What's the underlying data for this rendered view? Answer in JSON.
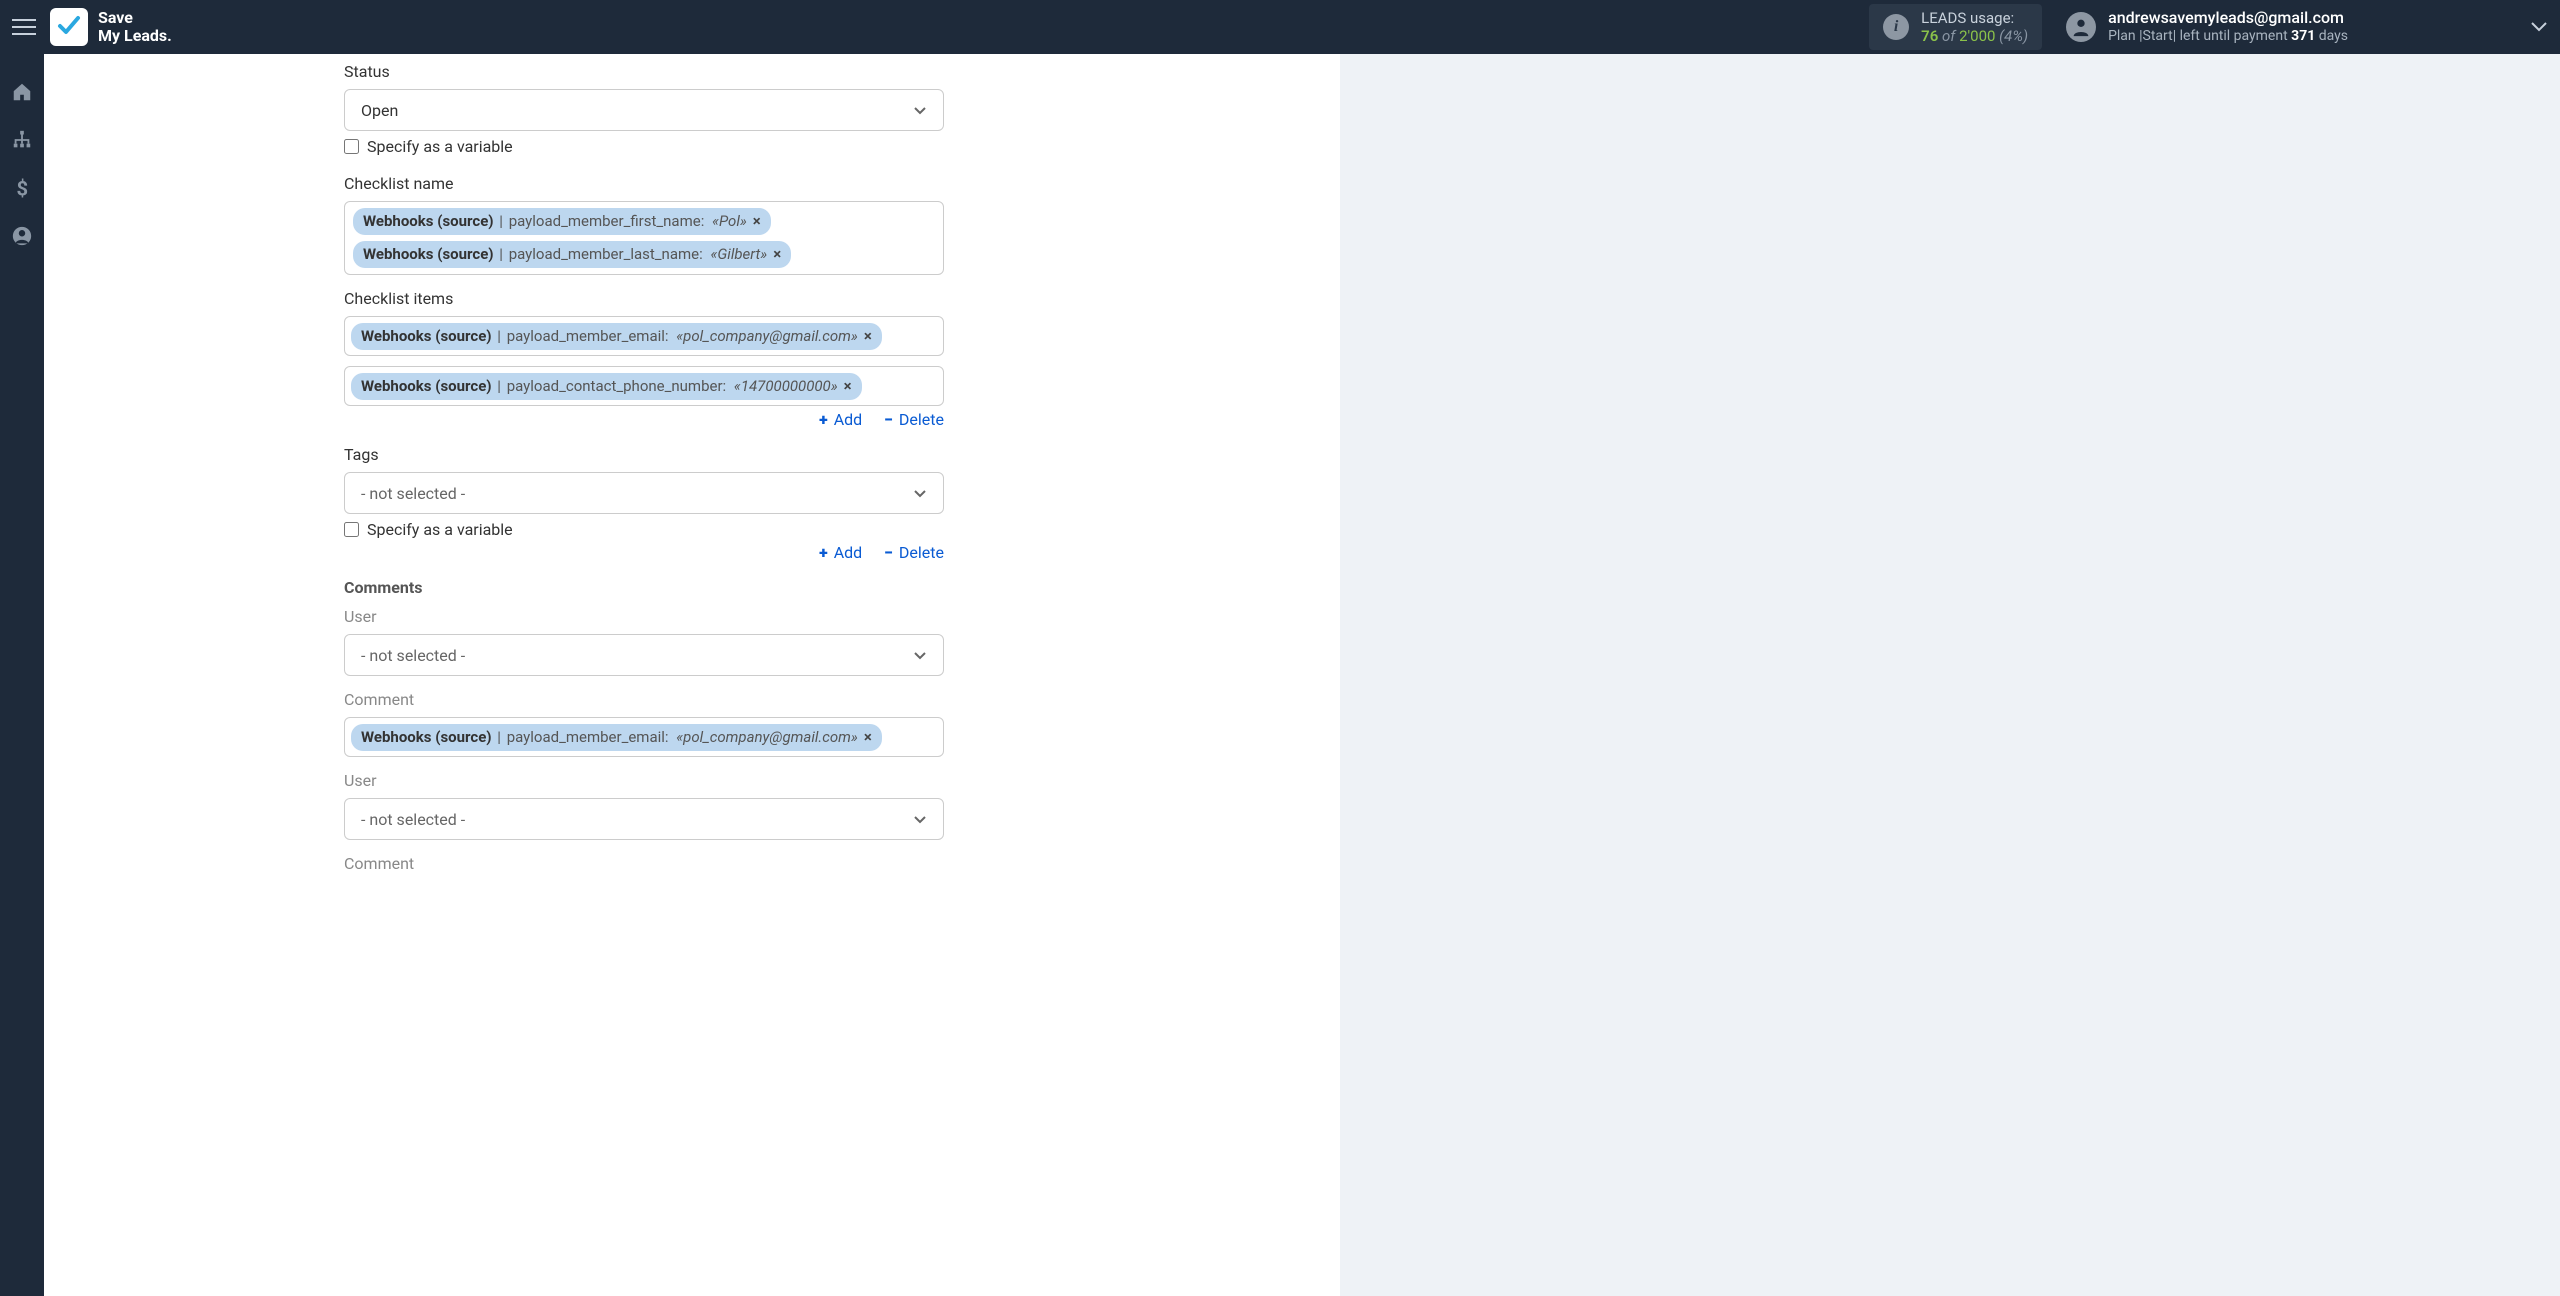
{
  "header": {
    "brand_line1": "Save",
    "brand_line2": "My Leads.",
    "leads_usage_label": "LEADS usage:",
    "leads_count": "76",
    "leads_of": "of",
    "leads_total": "2'000",
    "leads_pct": "(4%)",
    "account_email": "andrewsavemyleads@gmail.com",
    "plan_prefix": "Plan |Start| left until payment ",
    "plan_days": "371",
    "plan_suffix": " days"
  },
  "form": {
    "status_label": "Status",
    "status_value": "Open",
    "specify_variable_label": "Specify as a variable",
    "checklist_name_label": "Checklist name",
    "checklist_items_label": "Checklist items",
    "tags_label": "Tags",
    "tags_value": "- not selected -",
    "comments_label": "Comments",
    "user_label": "User",
    "user_value": "- not selected -",
    "comment_label": "Comment",
    "add_label": "Add",
    "delete_label": "Delete"
  },
  "chips": {
    "source_label": "Webhooks (source)",
    "first_name_field": "payload_member_first_name:",
    "first_name_value": "«Pol»",
    "last_name_field": "payload_member_last_name:",
    "last_name_value": "«Gilbert»",
    "email_field": "payload_member_email:",
    "email_value": "«pol_company@gmail.com»",
    "phone_field": "payload_contact_phone_number:",
    "phone_value": "«14700000000»"
  }
}
